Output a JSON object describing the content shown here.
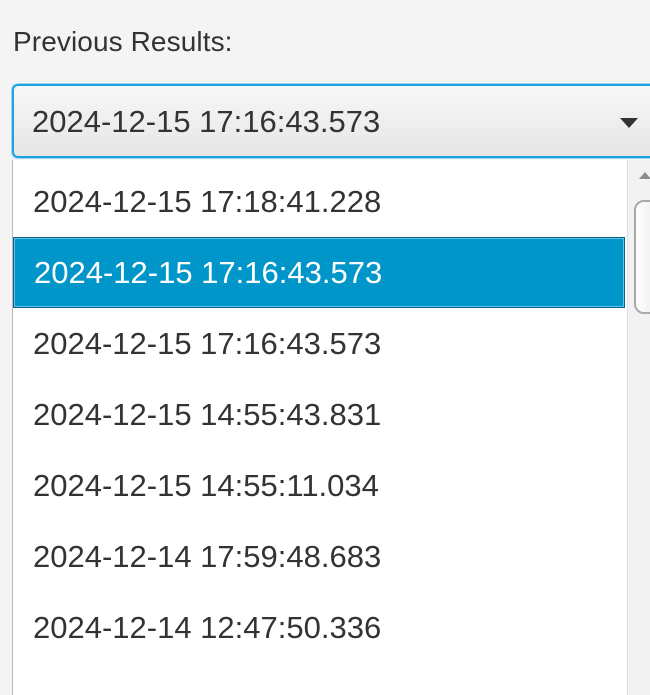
{
  "window": {
    "label": "Previous Results:"
  },
  "combo": {
    "selected_value": "2024-12-15 17:16:43.573",
    "arrow_icon": "chevron-down-icon"
  },
  "list": {
    "items": [
      {
        "label": "2024-12-15 17:18:41.228",
        "selected": false
      },
      {
        "label": "2024-12-15 17:16:43.573",
        "selected": true
      },
      {
        "label": "2024-12-15 17:16:43.573",
        "selected": false
      },
      {
        "label": "2024-12-15 14:55:43.831",
        "selected": false
      },
      {
        "label": "2024-12-15 14:55:11.034",
        "selected": false
      },
      {
        "label": "2024-12-14 17:59:48.683",
        "selected": false
      },
      {
        "label": "2024-12-14 12:47:50.336",
        "selected": false
      }
    ]
  },
  "colors": {
    "accent": "#1fa2e0",
    "selected_bg": "#0096c9",
    "text": "#333333"
  }
}
